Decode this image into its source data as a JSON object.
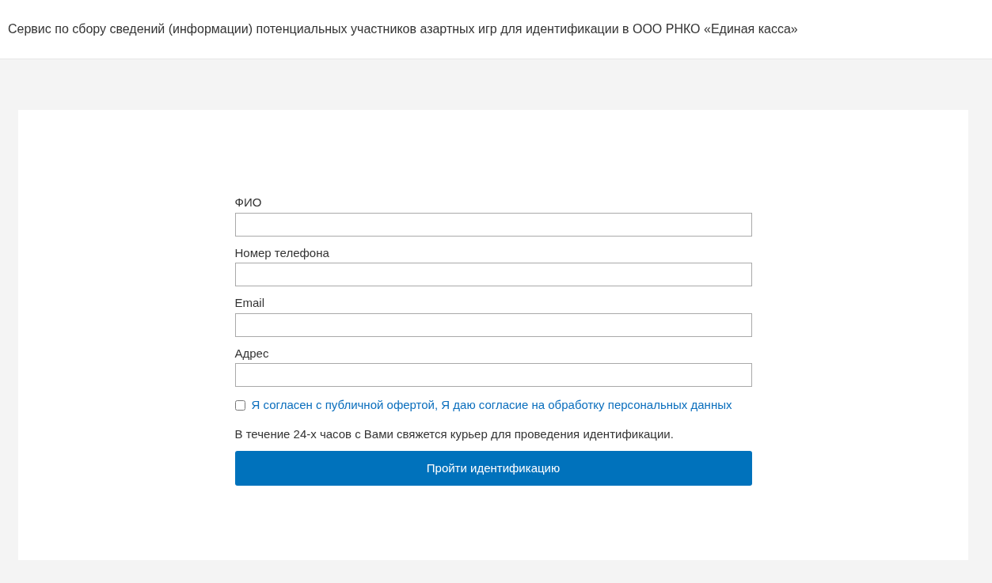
{
  "header": {
    "title": "Сервис по сбору сведений (информации) потенциальных участников азартных игр для идентификации в ООО РНКО «Единая касса»"
  },
  "form": {
    "fields": [
      {
        "label": "ФИО"
      },
      {
        "label": "Номер телефона"
      },
      {
        "label": "Email"
      },
      {
        "label": "Адрес"
      }
    ],
    "consent": {
      "label": "Я согласен с публичной офертой, Я даю согласие на обработку персональных данных",
      "checked": false
    },
    "note": "В течение 24-х часов с Вами свяжется курьер для проведения идентификации.",
    "submit": "Пройти идентификацию"
  }
}
